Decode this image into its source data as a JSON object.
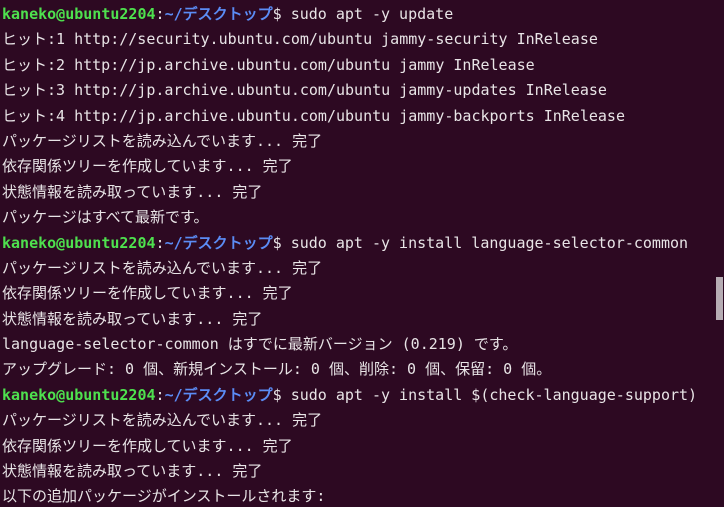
{
  "terminal": {
    "background_color": "#2d0922",
    "foreground_color": "#e8e4e6",
    "user_color": "#4ee14e",
    "path_color": "#5b8cf5",
    "scrollbar_thumb_color": "#b6acb3",
    "prompt": {
      "user_host": "kaneko@ubuntu2204",
      "separator": ":",
      "path": "~/デスクトップ",
      "sigil": "$ "
    },
    "lines": [
      {
        "type": "prompt",
        "command": "sudo apt -y update"
      },
      {
        "type": "output",
        "text": "ヒット:1 http://security.ubuntu.com/ubuntu jammy-security InRelease"
      },
      {
        "type": "output",
        "text": "ヒット:2 http://jp.archive.ubuntu.com/ubuntu jammy InRelease"
      },
      {
        "type": "output",
        "text": "ヒット:3 http://jp.archive.ubuntu.com/ubuntu jammy-updates InRelease"
      },
      {
        "type": "output",
        "text": "ヒット:4 http://jp.archive.ubuntu.com/ubuntu jammy-backports InRelease"
      },
      {
        "type": "output",
        "text": "パッケージリストを読み込んでいます... 完了"
      },
      {
        "type": "output",
        "text": "依存関係ツリーを作成しています... 完了"
      },
      {
        "type": "output",
        "text": "状態情報を読み取っています... 完了"
      },
      {
        "type": "output",
        "text": "パッケージはすべて最新です。"
      },
      {
        "type": "prompt",
        "command": "sudo apt -y install language-selector-common"
      },
      {
        "type": "output",
        "text": "パッケージリストを読み込んでいます... 完了"
      },
      {
        "type": "output",
        "text": "依存関係ツリーを作成しています... 完了"
      },
      {
        "type": "output",
        "text": "状態情報を読み取っています... 完了"
      },
      {
        "type": "output",
        "text": "language-selector-common はすでに最新バージョン (0.219) です。"
      },
      {
        "type": "output",
        "text": "アップグレード: 0 個、新規インストール: 0 個、削除: 0 個、保留: 0 個。"
      },
      {
        "type": "prompt",
        "command": "sudo apt -y install $(check-language-support)"
      },
      {
        "type": "output",
        "text": "パッケージリストを読み込んでいます... 完了"
      },
      {
        "type": "output",
        "text": "依存関係ツリーを作成しています... 完了"
      },
      {
        "type": "output",
        "text": "状態情報を読み取っています... 完了"
      },
      {
        "type": "output",
        "text": "以下の追加パッケージがインストールされます:"
      }
    ]
  }
}
